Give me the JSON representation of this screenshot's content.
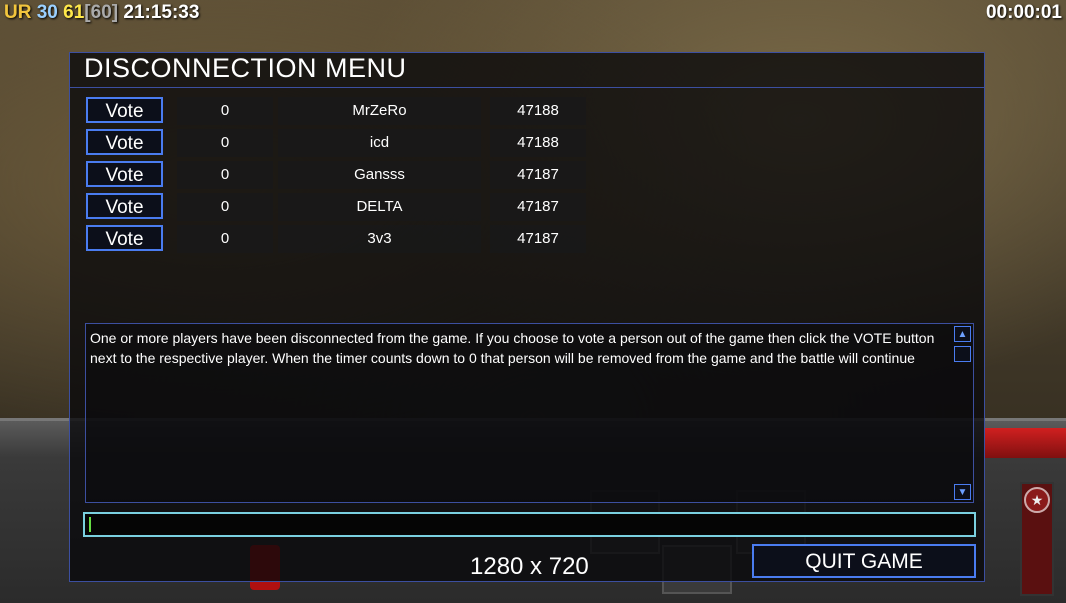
{
  "hud": {
    "ur_label": "UR",
    "val_30": "30",
    "val_61": "61",
    "val_60_bracket": "[60]",
    "clock": "21:15:33",
    "timer": "00:00:01"
  },
  "dialog": {
    "title": "DISCONNECTION MENU",
    "vote_label": "Vote",
    "players": [
      {
        "count": "0",
        "name": "MrZeRo",
        "ping": "47188"
      },
      {
        "count": "0",
        "name": "icd",
        "ping": "47188"
      },
      {
        "count": "0",
        "name": "Gansss",
        "ping": "47187"
      },
      {
        "count": "0",
        "name": "DELTA",
        "ping": "47187"
      },
      {
        "count": "0",
        "name": "3v3",
        "ping": "47187"
      }
    ],
    "message": "One or more players have been disconnected from the game. If you choose to vote a person out of the game then click the VOTE button next to the respective player. When the timer counts down to 0 that person will be removed from the game and the battle will continue",
    "chat_value": "",
    "resolution_text": "1280 x 720",
    "quit_label": "QUIT GAME"
  },
  "colors": {
    "accent_border": "#4a7cf0",
    "chat_border": "#7ad0e0",
    "hud_ur": "#f2c53d",
    "hud_30": "#9ad0ff",
    "hud_61": "#ffe84a"
  },
  "icons": [
    "scroll-up-icon",
    "scroll-down-icon",
    "star-emblem-icon"
  ]
}
